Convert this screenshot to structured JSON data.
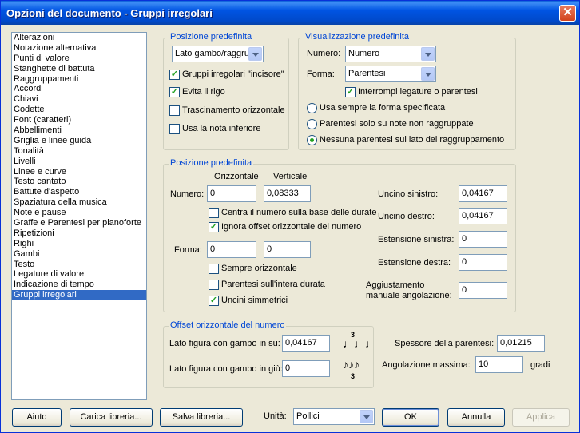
{
  "window": {
    "title": "Opzioni del documento - Gruppi irregolari",
    "close_glyph": "✕"
  },
  "categories": {
    "items": [
      "Alterazioni",
      "Notazione alternativa",
      "Punti di valore",
      "Stanghette di battuta",
      "Raggruppamenti",
      "Accordi",
      "Chiavi",
      "Codette",
      "Font (caratteri)",
      "Abbellimenti",
      "Griglia e linee guida",
      "Tonalità",
      "Livelli",
      "Linee e curve",
      "Testo cantato",
      "Battute d'aspetto",
      "Spaziatura della musica",
      "Note e pause",
      "Graffe e Parentesi per pianoforte",
      "Ripetizioni",
      "Righi",
      "Gambi",
      "Testo",
      "Legature di valore",
      "Indicazione di tempo",
      "Gruppi irregolari"
    ],
    "selected": "Gruppi irregolari"
  },
  "default_position": {
    "legend": "Posizione predefinita",
    "placement": "Lato gambo/raggru",
    "engraver_tuplets": {
      "label": "Gruppi irregolari \"incisore\"",
      "checked": "✓"
    },
    "avoid_staff": {
      "label": "Evita il rigo",
      "checked": "✓"
    },
    "horizontal_drag": {
      "label": "Trascinamento orizzontale",
      "checked": ""
    },
    "use_bottom_note": {
      "label": "Usa la nota inferiore",
      "checked": ""
    }
  },
  "default_display": {
    "legend": "Visualizzazione predefinita",
    "number_label": "Numero:",
    "number_value": "Numero",
    "shape_label": "Forma:",
    "shape_value": "Parentesi",
    "break_slurs": {
      "label": "Interrompi legature o parentesi",
      "checked": "✓"
    },
    "radio_always": "Usa sempre la forma specificata",
    "radio_unbeamed": "Parentesi solo su note non raggruppate",
    "radio_none_beam_side": "Nessuna parentesi sul lato del raggruppamento",
    "selected_radio": "radio_none_beam_side"
  },
  "position": {
    "legend": "Posizione predefinita",
    "col_horizontal": "Orizzontale",
    "col_vertical": "Verticale",
    "number_label": "Numero:",
    "number_h": "0",
    "number_v": "0,08333",
    "center_on_duration": {
      "label": "Centra il numero sulla base delle durate",
      "checked": ""
    },
    "ignore_h_offset": {
      "label": "Ignora offset orizzontale del numero",
      "checked": "✓"
    },
    "shape_label": "Forma:",
    "shape_h": "0",
    "shape_v": "0",
    "always_horizontal": {
      "label": "Sempre orizzontale",
      "checked": ""
    },
    "bracket_full_duration": {
      "label": "Parentesi sull'intera durata",
      "checked": ""
    },
    "symmetric_hooks": {
      "label": "Uncini simmetrici",
      "checked": "✓"
    },
    "left_hook_label": "Uncino sinistro:",
    "left_hook_value": "0,04167",
    "right_hook_label": "Uncino destro:",
    "right_hook_value": "0,04167",
    "left_ext_label": "Estensione sinistra:",
    "left_ext_value": "0",
    "right_ext_label": "Estensione destra:",
    "right_ext_value": "0",
    "manual_slope_label_1": "Aggiustamento",
    "manual_slope_label_2": "manuale angolazione:",
    "manual_slope_value": "0"
  },
  "number_offset": {
    "legend": "Offset orizzontale del numero",
    "stem_up_label": "Lato figura con gambo in su:",
    "stem_up_value": "0,04167",
    "stem_down_label": "Lato figura con gambo in giù:",
    "stem_down_value": "0",
    "stem_up_icon": "triplet-stem-up-icon",
    "stem_down_icon": "triplet-stem-down-icon",
    "icon_up_number": "3",
    "icon_down_number": "3",
    "icon_up_notes": "♩♩♩",
    "icon_down_notes": "♪♪♪"
  },
  "bracket_thickness_label": "Spessore della parentesi:",
  "bracket_thickness_value": "0,01215",
  "max_slope_label": "Angolazione massima:",
  "max_slope_value": "10",
  "max_slope_unit": "gradi",
  "footer": {
    "help": "Aiuto",
    "load_library": "Carica libreria...",
    "save_library": "Salva libreria...",
    "units_label": "Unità:",
    "units_value": "Pollici",
    "ok": "OK",
    "cancel": "Annulla",
    "apply": "Applica"
  },
  "colors": {
    "title_bar": "#0054e3",
    "legend": "#0046d5",
    "selection": "#316ac5",
    "check": "#21a121"
  }
}
